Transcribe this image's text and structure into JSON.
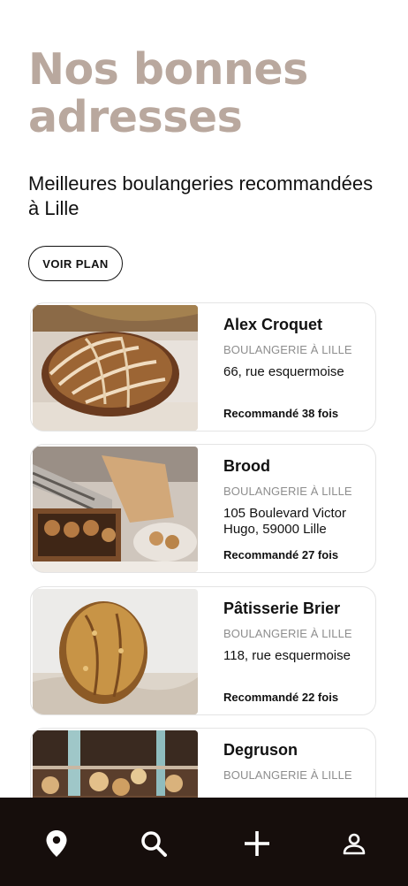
{
  "header": {
    "title": "Nos bonnes adresses",
    "subtitle": "Meilleures boulangeries recommandées à Lille",
    "map_button_label": "VOIR PLAN"
  },
  "bakeries": [
    {
      "name": "Alex Croquet",
      "category": "BOULANGERIE À LILLE",
      "address": "66, rue esquermoise",
      "recommended": "Recommandé 38 fois",
      "image": "sourdough-bread-photo"
    },
    {
      "name": "Brood",
      "category": "BOULANGERIE À LILLE",
      "address": "105 Boulevard Victor Hugo, 59000 Lille",
      "recommended": "Recommandé 27 fois",
      "image": "pastry-display-photo"
    },
    {
      "name": "Pâtisserie Brier",
      "category": "BOULANGERIE À LILLE",
      "address": "118, rue esquermoise",
      "recommended": "Recommandé 22 fois",
      "image": "round-loaf-photo"
    },
    {
      "name": "Degruson",
      "category": "BOULANGERIE À LILLE",
      "address": "",
      "recommended": "",
      "image": "bakery-counter-photo"
    }
  ],
  "tabbar": {
    "items": [
      "location-pin-icon",
      "search-icon",
      "add-icon",
      "profile-icon"
    ]
  },
  "colors": {
    "title": "#b9a89e",
    "tabbar_bg": "#160e0c",
    "card_border": "#e4e4e4"
  }
}
